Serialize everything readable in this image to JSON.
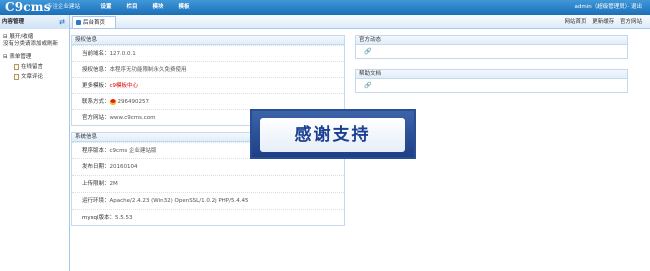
{
  "topbar": {
    "logo": "C9cms",
    "slogan": "专注企业建站",
    "nav": [
      "设置",
      "栏目",
      "模块",
      "模板"
    ],
    "user": "admin（超级管理员）· 退出"
  },
  "subbar": {
    "side_title": "内容管理",
    "home_tab": "后台首页",
    "links": [
      "网站首页",
      "更新缓存",
      "官方网站"
    ]
  },
  "sidebar": {
    "expand_label": "展开/收缩",
    "hint": "没有分类请添加或刷新",
    "root": "表单管理",
    "items": [
      "在线留言",
      "文章评论"
    ]
  },
  "auth_panel": {
    "title": "授权信息",
    "rows": [
      {
        "k": "当前域名：",
        "v": "127.0.0.1"
      },
      {
        "k": "授权信息：",
        "v": "本程序无功能限制永久免费使用"
      },
      {
        "k": "更多模板：",
        "v": "c9模板中心"
      },
      {
        "k": "联系方式：",
        "v": "296490257"
      },
      {
        "k": "官方网站：",
        "v": "www.c9cms.com"
      }
    ]
  },
  "sys_panel": {
    "title": "系统信息",
    "rows": [
      {
        "k": "程序版本：",
        "v": "c9cms 企业建站版"
      },
      {
        "k": "发布日期：",
        "v": "20160104"
      },
      {
        "k": "上传限制：",
        "v": "2M"
      },
      {
        "k": "运行环境：",
        "v": "Apache/2.4.23 (Win32) OpenSSL/1.0.2j PHP/5.4.45"
      },
      {
        "k": "mysql版本：",
        "v": "5.5.53"
      }
    ]
  },
  "news_panel": {
    "title": "官方动态"
  },
  "help_panel": {
    "title": "帮助文档"
  },
  "banner": {
    "text": "感谢支持"
  },
  "colors": {
    "header": "#1b6fb8",
    "border": "#c5d9ee",
    "link_red": "#e00000"
  }
}
